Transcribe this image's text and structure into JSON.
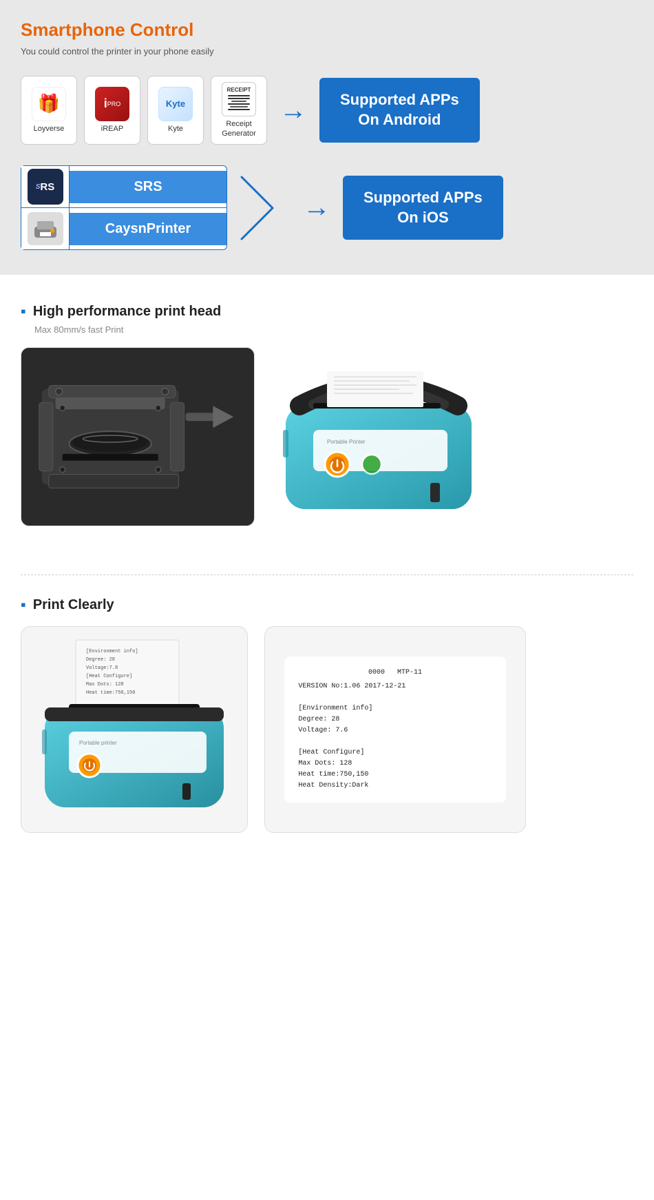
{
  "smartphone_section": {
    "title": "Smartphone Control",
    "subtitle": "You could control the printer in your phone easily",
    "android_apps": [
      {
        "name": "Loyverse",
        "icon_type": "loyverse"
      },
      {
        "name": "iREAP",
        "icon_type": "ireap"
      },
      {
        "name": "Kyte",
        "icon_type": "kyte"
      },
      {
        "name": "Receipt\nGenerator",
        "icon_type": "receipt"
      }
    ],
    "android_badge": "Supported APPs\nOn Android",
    "ios_apps": [
      {
        "name": "SRS",
        "icon_type": "srs"
      },
      {
        "name": "CaysnPrinter",
        "icon_type": "printer"
      }
    ],
    "ios_badge": "Supported APPs\nOn iOS"
  },
  "features": {
    "print_head": {
      "title": "High performance print head",
      "subtitle": "Max 80mm/s fast Print"
    },
    "print_clearly": {
      "title": "Print Clearly"
    }
  },
  "receipt_content": {
    "lines": [
      "VERSION No:1.06 2017-12-21",
      "[Environment info]",
      "Degree: 28",
      "Voltage: 7.6",
      "[Heat Configure]",
      "Max Dots: 128",
      "Heat time:750,150",
      "Heat Density:Dark"
    ]
  }
}
